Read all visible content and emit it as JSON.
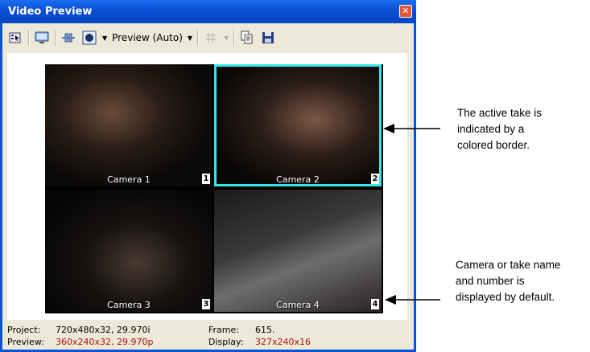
{
  "window": {
    "title": "Video Preview",
    "close_glyph": "✕"
  },
  "toolbar": {
    "preview_mode_label": "Preview (Auto)",
    "icons": [
      "video-properties-icon",
      "external-monitor-icon",
      "split-screen-icon",
      "mode-icon",
      "dropdown-icon",
      "grid-icon",
      "copy-snapshot-icon",
      "save-snapshot-icon"
    ]
  },
  "cameras": [
    {
      "label": "Camera 1",
      "number": "1",
      "active": false
    },
    {
      "label": "Camera 2",
      "number": "2",
      "active": true
    },
    {
      "label": "Camera 3",
      "number": "3",
      "active": false
    },
    {
      "label": "Camera 4",
      "number": "4",
      "active": false
    }
  ],
  "status": {
    "project_key": "Project:",
    "project_value": "720x480x32, 29.970i",
    "frame_key": "Frame:",
    "frame_value": "615.",
    "preview_key": "Preview:",
    "preview_value": "360x240x32, 29.970p",
    "display_key": "Display:",
    "display_value": "327x240x16"
  },
  "annotations": {
    "active_take_line1": "The active take is",
    "active_take_line2": "indicated by a",
    "active_take_line3": "colored border.",
    "name_line1": "Camera or take name",
    "name_line2": "and number is",
    "name_line3": "displayed by default."
  },
  "colors": {
    "active_border": "#35e6e6",
    "titlebar": "#0a53d6",
    "status_value_red": "#b11010"
  }
}
